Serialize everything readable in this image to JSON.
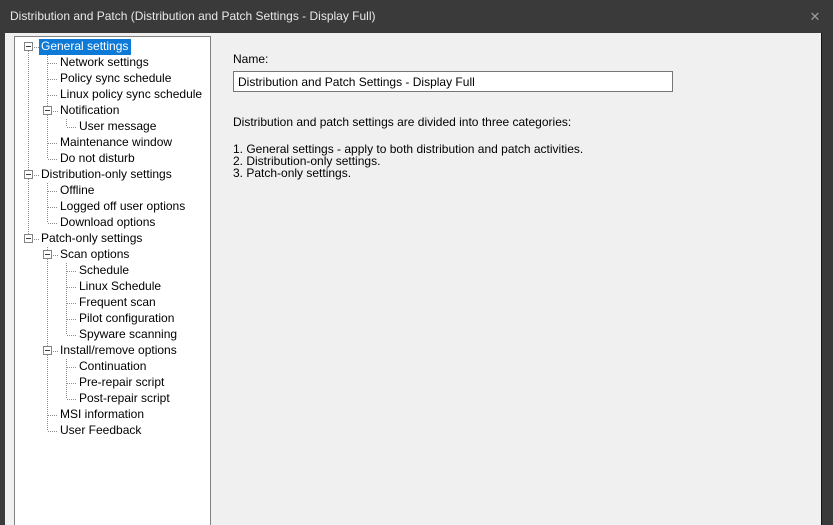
{
  "window": {
    "title": "Distribution and Patch (Distribution and Patch Settings - Display Full)",
    "close_icon": "✕"
  },
  "colors": {
    "titlebar_bg": "#3a3a3a",
    "selection": "#0d7ad8",
    "panel_bg": "#f0f0f0",
    "tree_bg": "#ffffff"
  },
  "main": {
    "name_label": "Name:",
    "name_value": "Distribution and Patch Settings - Display Full",
    "description": "Distribution and patch settings are divided into three categories:",
    "categories": [
      "1. General settings - apply to both distribution and patch activities.",
      "2. Distribution-only settings.",
      "3. Patch-only settings."
    ]
  },
  "tree": {
    "items": [
      {
        "label": "General settings",
        "depth": 0,
        "expander": true,
        "selected": true
      },
      {
        "label": "Network settings",
        "depth": 1,
        "expander": false,
        "selected": false
      },
      {
        "label": "Policy sync schedule",
        "depth": 1,
        "expander": false,
        "selected": false
      },
      {
        "label": "Linux policy sync schedule",
        "depth": 1,
        "expander": false,
        "selected": false
      },
      {
        "label": "Notification",
        "depth": 1,
        "expander": true,
        "selected": false
      },
      {
        "label": "User message",
        "depth": 2,
        "expander": false,
        "selected": false
      },
      {
        "label": "Maintenance window",
        "depth": 1,
        "expander": false,
        "selected": false
      },
      {
        "label": "Do not disturb",
        "depth": 1,
        "expander": false,
        "selected": false
      },
      {
        "label": "Distribution-only settings",
        "depth": 0,
        "expander": true,
        "selected": false
      },
      {
        "label": "Offline",
        "depth": 1,
        "expander": false,
        "selected": false
      },
      {
        "label": "Logged off user options",
        "depth": 1,
        "expander": false,
        "selected": false
      },
      {
        "label": "Download options",
        "depth": 1,
        "expander": false,
        "selected": false
      },
      {
        "label": "Patch-only settings",
        "depth": 0,
        "expander": true,
        "selected": false
      },
      {
        "label": "Scan options",
        "depth": 1,
        "expander": true,
        "selected": false
      },
      {
        "label": "Schedule",
        "depth": 2,
        "expander": false,
        "selected": false
      },
      {
        "label": "Linux Schedule",
        "depth": 2,
        "expander": false,
        "selected": false
      },
      {
        "label": "Frequent scan",
        "depth": 2,
        "expander": false,
        "selected": false
      },
      {
        "label": "Pilot configuration",
        "depth": 2,
        "expander": false,
        "selected": false
      },
      {
        "label": "Spyware scanning",
        "depth": 2,
        "expander": false,
        "selected": false
      },
      {
        "label": "Install/remove options",
        "depth": 1,
        "expander": true,
        "selected": false
      },
      {
        "label": "Continuation",
        "depth": 2,
        "expander": false,
        "selected": false
      },
      {
        "label": "Pre-repair script",
        "depth": 2,
        "expander": false,
        "selected": false
      },
      {
        "label": "Post-repair script",
        "depth": 2,
        "expander": false,
        "selected": false
      },
      {
        "label": "MSI information",
        "depth": 1,
        "expander": false,
        "selected": false
      },
      {
        "label": "User Feedback",
        "depth": 1,
        "expander": false,
        "selected": false
      }
    ]
  }
}
